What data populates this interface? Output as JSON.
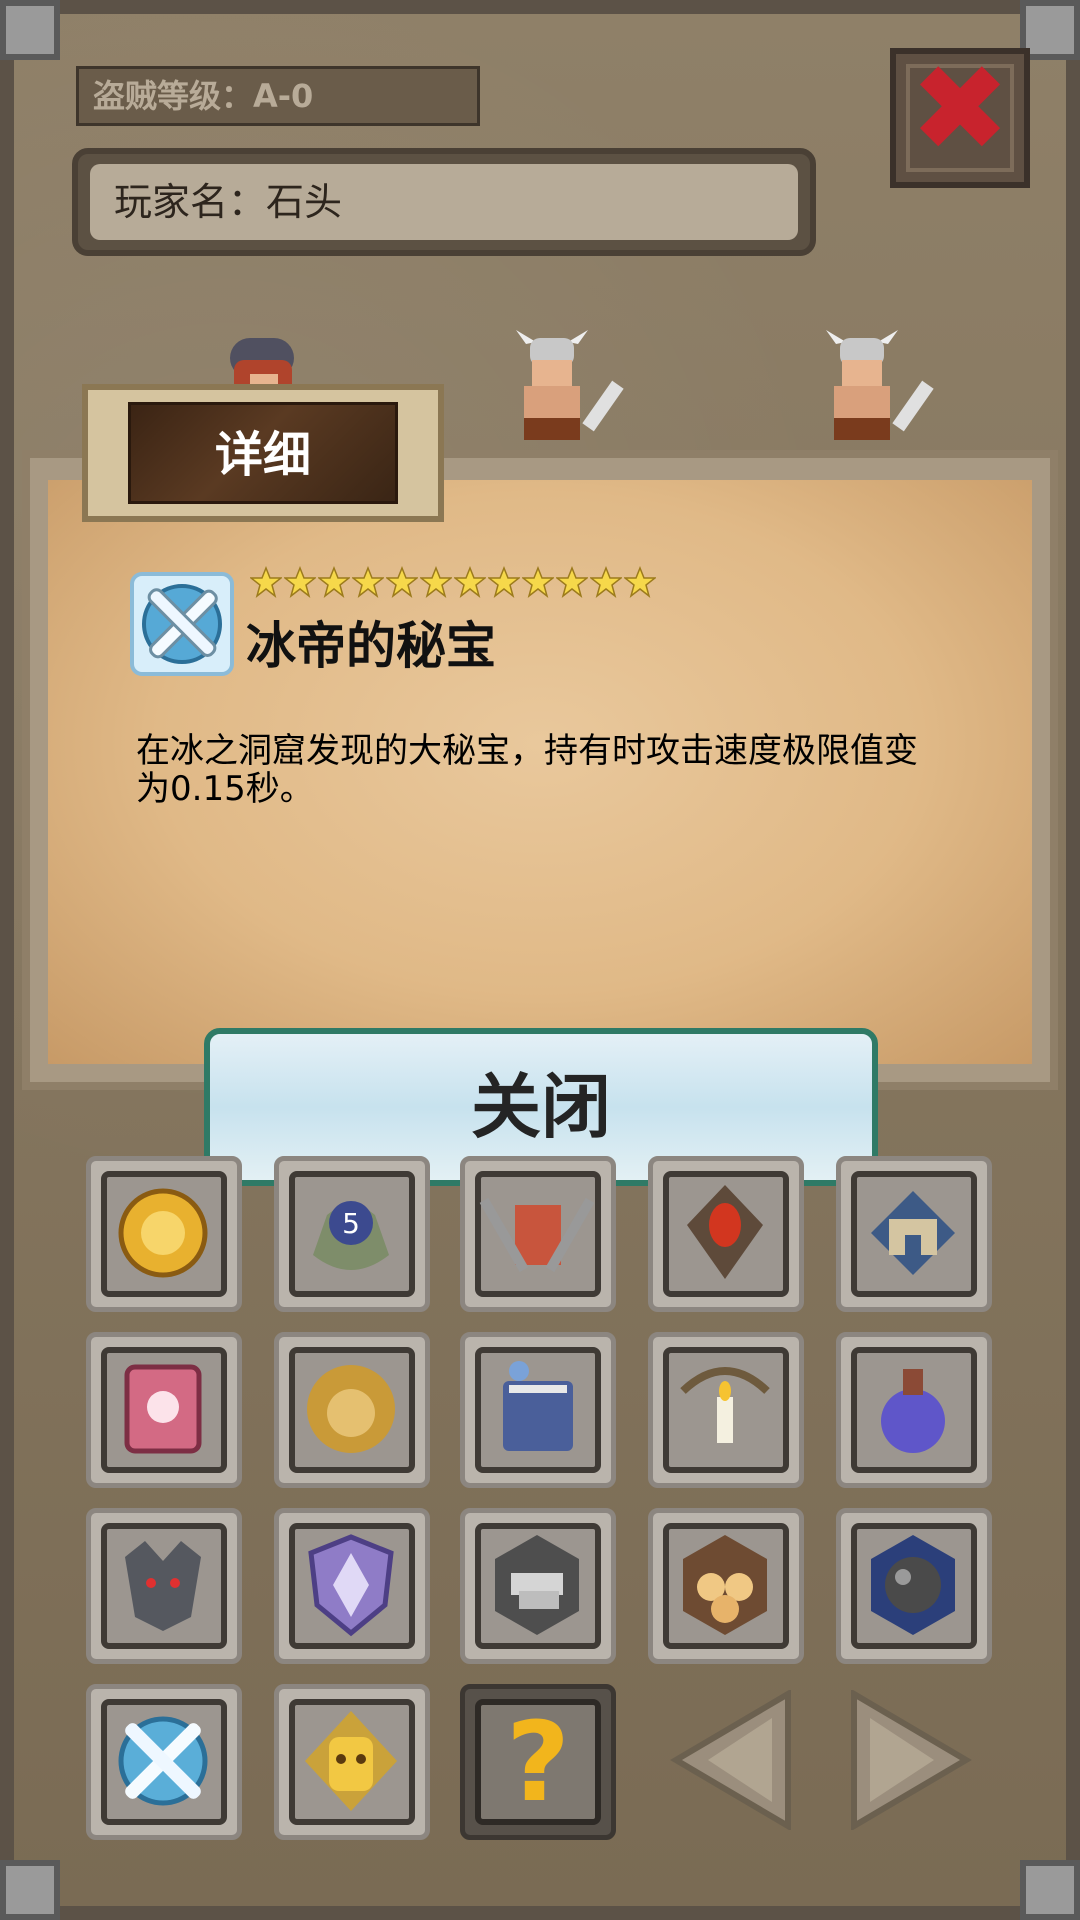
{
  "header": {
    "rank_text": "盗贼等级：A-0",
    "player_name_text": "玩家名：石头"
  },
  "dialog": {
    "tab_label": "详细",
    "item_title": "冰帝的秘宝",
    "star_count": 12,
    "description": "在冰之洞窟发现的大秘宝，持有时攻击速度极限值变为0.15秒。",
    "close_label": "关闭"
  },
  "collection": {
    "items": [
      {
        "name": "golden-medal-icon"
      },
      {
        "name": "number5-emblem-icon"
      },
      {
        "name": "banner-swords-icon"
      },
      {
        "name": "ruby-crest-icon"
      },
      {
        "name": "castle-badge-icon"
      },
      {
        "name": "pink-book-icon"
      },
      {
        "name": "lion-head-icon"
      },
      {
        "name": "blue-book-icon"
      },
      {
        "name": "pickaxe-candle-icon"
      },
      {
        "name": "potion-flask-icon"
      },
      {
        "name": "wolf-head-icon"
      },
      {
        "name": "purple-shield-icon"
      },
      {
        "name": "silver-bars-icon"
      },
      {
        "name": "wood-logs-icon"
      },
      {
        "name": "iron-ore-icon"
      },
      {
        "name": "ice-swords-icon"
      },
      {
        "name": "golden-mask-icon"
      }
    ],
    "unknown_symbol": "?"
  },
  "colors": {
    "close_x": "#c8232d",
    "star": "#f6d84a",
    "question": "#f2b51c"
  }
}
